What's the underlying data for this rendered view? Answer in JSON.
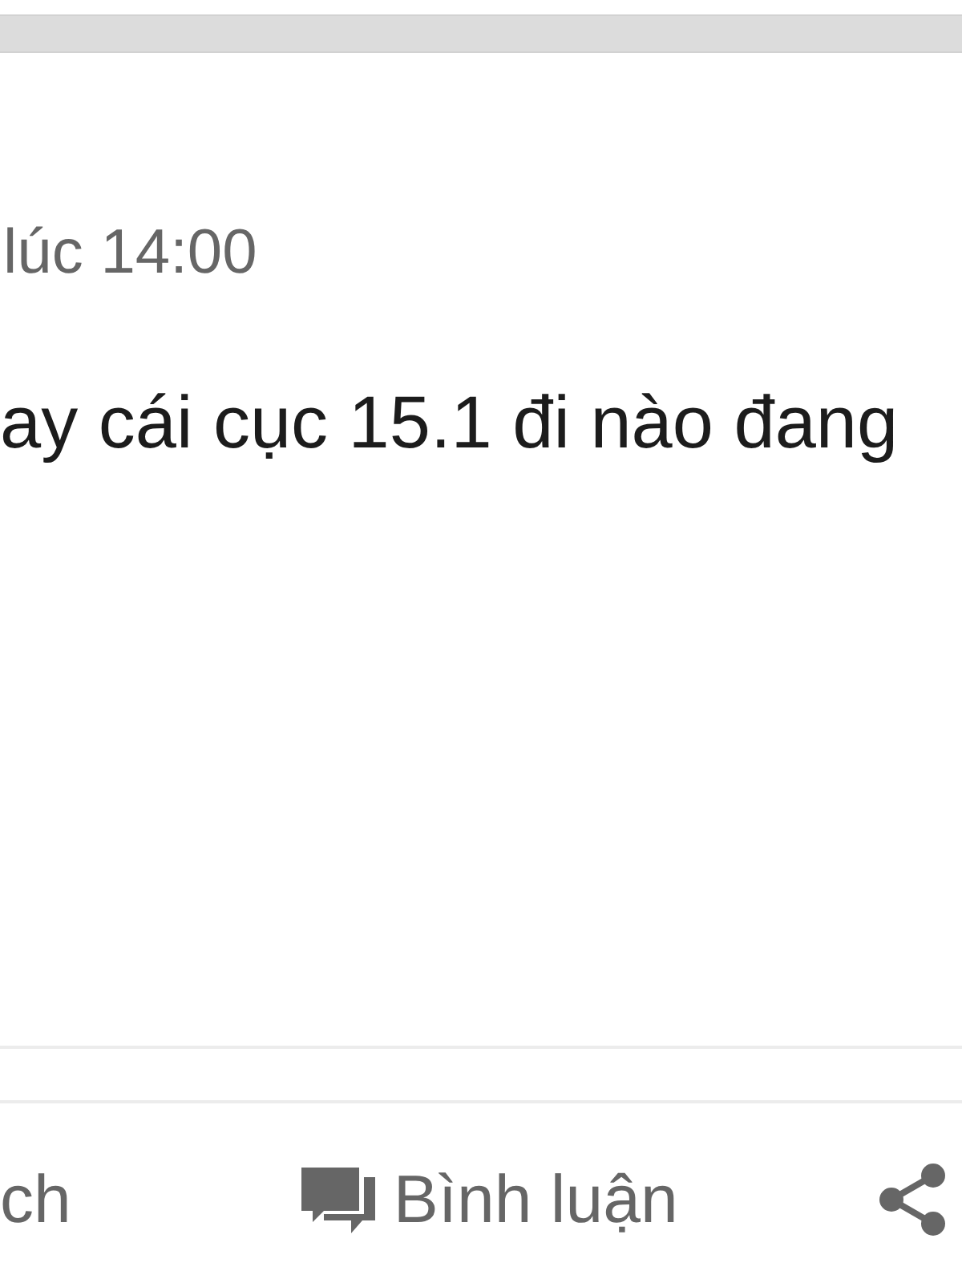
{
  "post": {
    "timestamp": "lúc 14:00",
    "text": "ay cái cục 15.1 đi nào đang"
  },
  "actions": [
    {
      "kind": "reaction",
      "label": "ch"
    },
    {
      "kind": "comment",
      "label": "Bình luận"
    },
    {
      "kind": "share"
    }
  ]
}
